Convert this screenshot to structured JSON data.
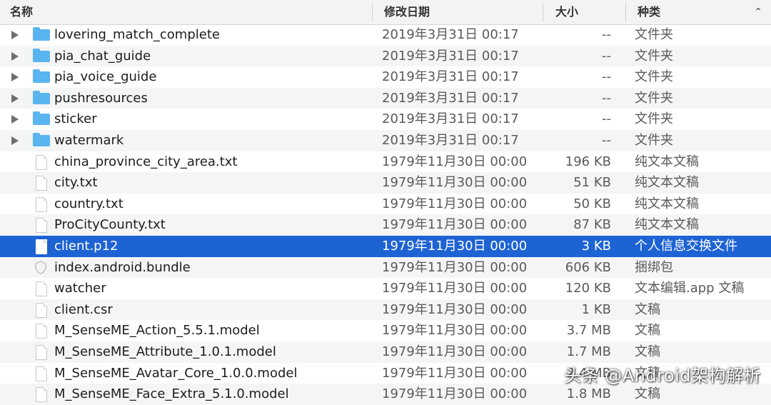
{
  "columns": {
    "name": "名称",
    "date": "修改日期",
    "size": "大小",
    "kind": "种类",
    "sort_icon": "chevron-up-icon"
  },
  "rows": [
    {
      "name": "lovering_match_complete",
      "date": "2019年3月31日 00:17",
      "size": "--",
      "kind": "文件夹",
      "type": "folder"
    },
    {
      "name": "pia_chat_guide",
      "date": "2019年3月31日 00:17",
      "size": "--",
      "kind": "文件夹",
      "type": "folder"
    },
    {
      "name": "pia_voice_guide",
      "date": "2019年3月31日 00:17",
      "size": "--",
      "kind": "文件夹",
      "type": "folder"
    },
    {
      "name": "pushresources",
      "date": "2019年3月31日 00:17",
      "size": "--",
      "kind": "文件夹",
      "type": "folder"
    },
    {
      "name": "sticker",
      "date": "2019年3月31日 00:17",
      "size": "--",
      "kind": "文件夹",
      "type": "folder"
    },
    {
      "name": "watermark",
      "date": "2019年3月31日 00:17",
      "size": "--",
      "kind": "文件夹",
      "type": "folder"
    },
    {
      "name": "china_province_city_area.txt",
      "date": "1979年11月30日 00:00",
      "size": "196 KB",
      "kind": "纯文本文稿",
      "type": "file"
    },
    {
      "name": "city.txt",
      "date": "1979年11月30日 00:00",
      "size": "51 KB",
      "kind": "纯文本文稿",
      "type": "file"
    },
    {
      "name": "country.txt",
      "date": "1979年11月30日 00:00",
      "size": "50 KB",
      "kind": "纯文本文稿",
      "type": "file"
    },
    {
      "name": "ProCityCounty.txt",
      "date": "1979年11月30日 00:00",
      "size": "87 KB",
      "kind": "纯文本文稿",
      "type": "file"
    },
    {
      "name": "client.p12",
      "date": "1979年11月30日 00:00",
      "size": "3 KB",
      "kind": "个人信息交换文件",
      "type": "file",
      "selected": true
    },
    {
      "name": "index.android.bundle",
      "date": "1979年11月30日 00:00",
      "size": "606 KB",
      "kind": "捆绑包",
      "type": "bundle"
    },
    {
      "name": "watcher",
      "date": "1979年11月30日 00:00",
      "size": "120 KB",
      "kind": "文本编辑.app 文稿",
      "type": "file"
    },
    {
      "name": "client.csr",
      "date": "1979年11月30日 00:00",
      "size": "1 KB",
      "kind": "文稿",
      "type": "file"
    },
    {
      "name": "M_SenseME_Action_5.5.1.model",
      "date": "1979年11月30日 00:00",
      "size": "3.7 MB",
      "kind": "文稿",
      "type": "file"
    },
    {
      "name": "M_SenseME_Attribute_1.0.1.model",
      "date": "1979年11月30日 00:00",
      "size": "1.7 MB",
      "kind": "文稿",
      "type": "file"
    },
    {
      "name": "M_SenseME_Avatar_Core_1.0.0.model",
      "date": "1979年11月30日 00:00",
      "size": "2.4 MB",
      "kind": "文稿",
      "type": "file"
    },
    {
      "name": "M_SenseME_Face_Extra_5.1.0.model",
      "date": "1979年11月30日 00:00",
      "size": "1.8 MB",
      "kind": "文稿",
      "type": "file"
    }
  ],
  "watermark": "头条 @Android架构解析",
  "colors": {
    "selection": "#1e63d4",
    "folder": "#5ab4f0",
    "alt_row": "#f4f5f5"
  }
}
